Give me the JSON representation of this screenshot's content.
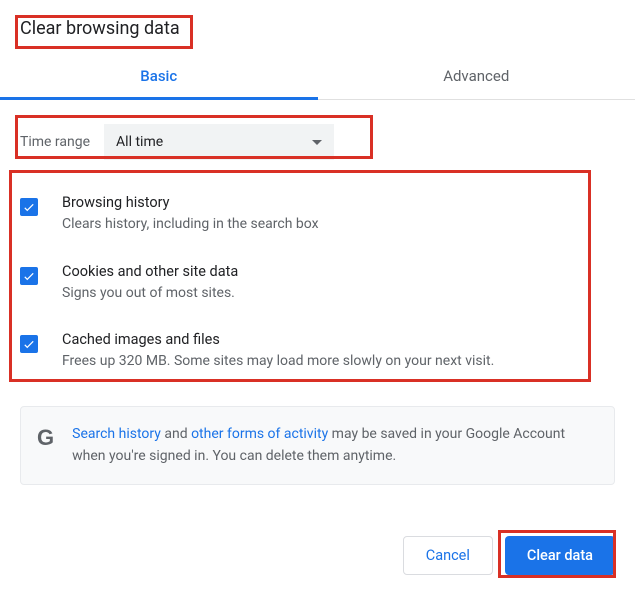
{
  "title": "Clear browsing data",
  "tabs": {
    "basic": "Basic",
    "advanced": "Advanced"
  },
  "time_range": {
    "label": "Time range",
    "value": "All time"
  },
  "options": [
    {
      "title": "Browsing history",
      "desc": "Clears history, including in the search box"
    },
    {
      "title": "Cookies and other site data",
      "desc": "Signs you out of most sites."
    },
    {
      "title": "Cached images and files",
      "desc": "Frees up 320 MB. Some sites may load more slowly on your next visit."
    }
  ],
  "info": {
    "link1": "Search history",
    "mid1": " and ",
    "link2": "other forms of activity",
    "tail": " may be saved in your Google Account when you're signed in. You can delete them anytime."
  },
  "buttons": {
    "cancel": "Cancel",
    "clear": "Clear data"
  }
}
